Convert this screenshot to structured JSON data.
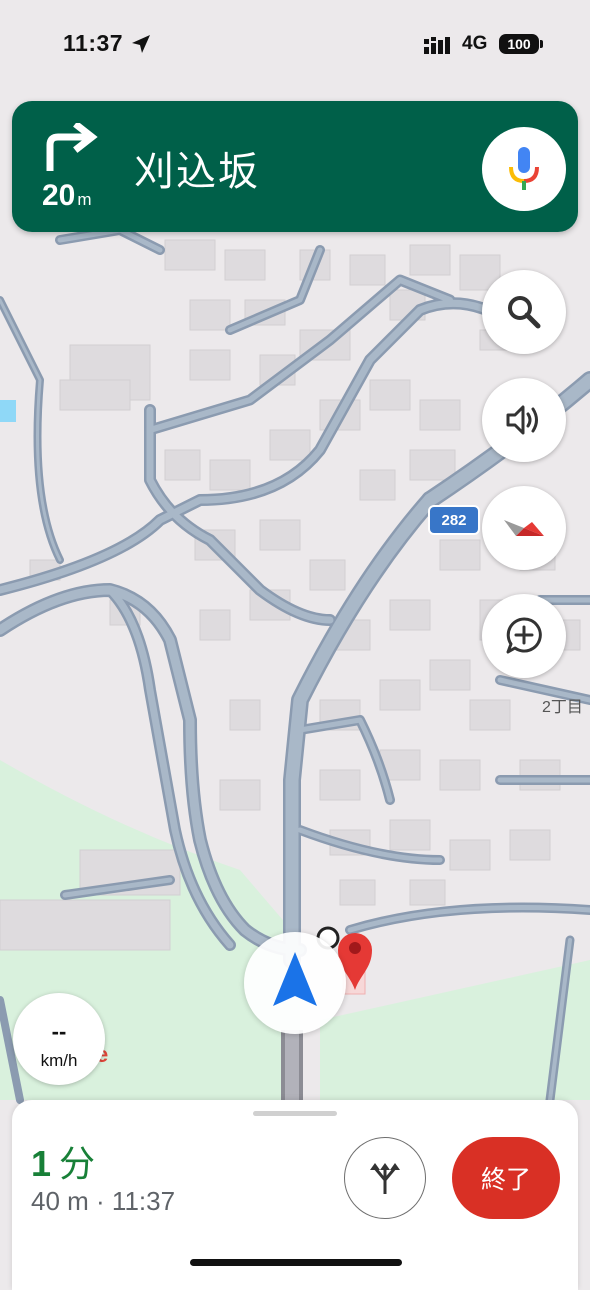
{
  "status_bar": {
    "time": "11:37",
    "network": "4G",
    "battery": "100"
  },
  "navigation": {
    "turn_icon": "turn-right-arrow-icon",
    "distance_value": "20",
    "distance_unit": "m",
    "street_name": "刈込坂",
    "voice_icon": "microphone-icon"
  },
  "map_controls": [
    {
      "name": "search-icon"
    },
    {
      "name": "volume-icon"
    },
    {
      "name": "compass-icon"
    },
    {
      "name": "report-incident-icon"
    }
  ],
  "map": {
    "route_badge": "282",
    "area_label": "2丁目",
    "colors": {
      "road": "#a7b6c6",
      "road_edge": "#8b9bb0",
      "land": "#ece9eb",
      "park": "#d8f0dc",
      "water": "#8fd8f7",
      "building": "#dddadd"
    }
  },
  "speed": {
    "value": "--",
    "unit": "km/h"
  },
  "bottom_sheet": {
    "eta_value": "1",
    "eta_unit": "分",
    "trip_info": "40 m · 11:37",
    "alternate_routes_icon": "alternate-routes-icon",
    "end_label": "終了"
  },
  "accent_colors": {
    "banner": "#006049",
    "end": "#d93025",
    "eta": "#188038",
    "nav_arrow": "#1a73e8"
  }
}
